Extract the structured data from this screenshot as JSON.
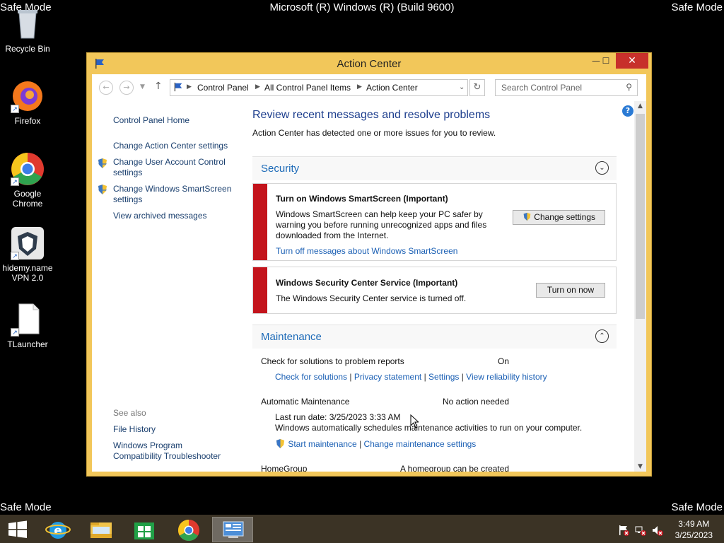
{
  "desktop": {
    "safe_mode": "Safe Mode",
    "os_build": "Microsoft (R) Windows (R) (Build 9600)",
    "icons": [
      {
        "label": "Recycle Bin",
        "icon": "recycle-bin-icon"
      },
      {
        "label": "Firefox",
        "icon": "firefox-icon"
      },
      {
        "label": "Google Chrome",
        "icon": "chrome-icon"
      },
      {
        "label": "hidemy.name VPN 2.0",
        "icon": "vpn-icon"
      },
      {
        "label": "TLauncher",
        "icon": "file-icon"
      }
    ]
  },
  "window": {
    "title": "Action Center",
    "accent_color": "#f2c75a",
    "breadcrumb": [
      "Control Panel",
      "All Control Panel Items",
      "Action Center"
    ],
    "search_placeholder": "Search Control Panel"
  },
  "sidebar": {
    "home": "Control Panel Home",
    "links": [
      "Change Action Center settings",
      "Change User Account Control settings",
      "Change Windows SmartScreen settings",
      "View archived messages"
    ],
    "see_also": "See also",
    "see_also_links": [
      "File History",
      "Windows Program Compatibility Troubleshooter"
    ]
  },
  "main": {
    "heading": "Review recent messages and resolve problems",
    "subheading": "Action Center has detected one or more issues for you to review.",
    "security": {
      "label": "Security",
      "alerts": [
        {
          "title": "Turn on Windows SmartScreen  (Important)",
          "text1": "Windows SmartScreen can help keep your PC safer by",
          "text2": "warning you before running unrecognized apps and files",
          "text3": "downloaded from the Internet.",
          "link": "Turn off messages about Windows SmartScreen",
          "button": "Change settings"
        },
        {
          "title": "Windows Security Center Service  (Important)",
          "text1": "The Windows Security Center service is turned off.",
          "button": "Turn on now"
        }
      ]
    },
    "maintenance": {
      "label": "Maintenance",
      "problem_reports_label": "Check for solutions to problem reports",
      "problem_reports_value": "On",
      "links": [
        "Check for solutions",
        "Privacy statement",
        "Settings",
        "View reliability history"
      ],
      "auto_label": "Automatic Maintenance",
      "auto_value": "No action needed",
      "last_run": "Last run date: 3/25/2023 3:33 AM",
      "auto_desc": "Windows automatically schedules maintenance activities to run on your computer.",
      "start": "Start maintenance",
      "change": "Change maintenance settings",
      "homegroup_label": "HomeGroup",
      "homegroup_value": "A homegroup can be created"
    }
  },
  "taskbar": {
    "time": "3:49 AM",
    "date": "3/25/2023"
  }
}
